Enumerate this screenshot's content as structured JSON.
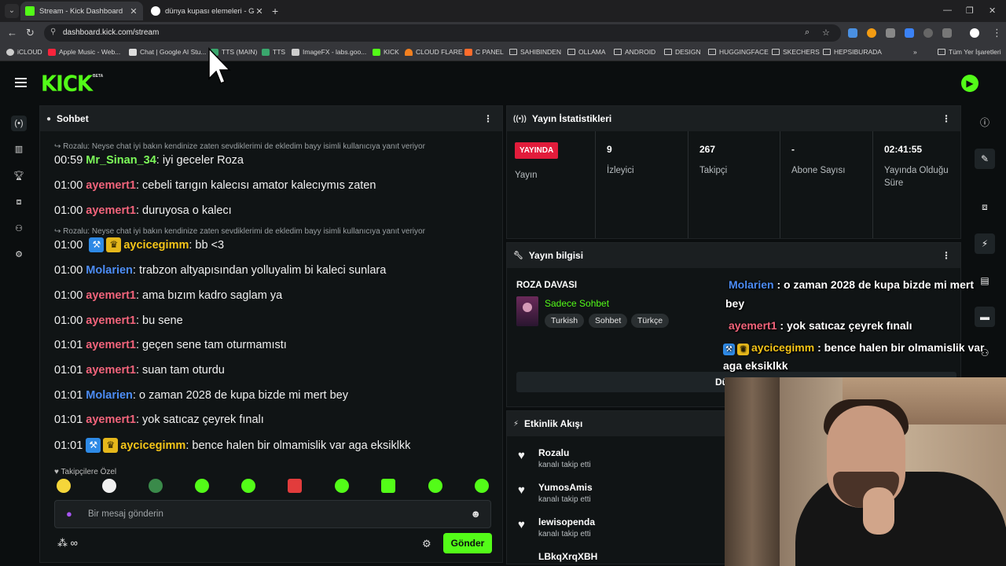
{
  "browser": {
    "tabs": [
      {
        "title": "Stream - Kick Dashboard",
        "favicon_color": "#53fc18",
        "active": true
      },
      {
        "title": "dünya kupası elemeleri - Google",
        "favicon_color": "#ffffff",
        "active": false
      }
    ],
    "url": "dashboard.kick.com/stream",
    "bookmarks": [
      {
        "label": "iCLOUD",
        "color": "#e8e8e8"
      },
      {
        "label": "Apple Music - Web...",
        "color": "#fa243c"
      },
      {
        "label": "Chat | Google AI Stu...",
        "color": "#dddddd"
      },
      {
        "label": "TTS (MAIN)",
        "color": "#3aa76d"
      },
      {
        "label": "TTS",
        "color": "#3aa76d"
      },
      {
        "label": "ImageFX - labs.goo...",
        "color": "#cccccc"
      },
      {
        "label": "KICK",
        "color": "#53fc18"
      },
      {
        "label": "CLOUD FLARE",
        "color": "#f38020"
      },
      {
        "label": "C PANEL",
        "color": "#ff6c2c"
      },
      {
        "label": "SAHIBINDEN",
        "folder": true
      },
      {
        "label": "OLLAMA",
        "folder": true
      },
      {
        "label": "ANDROID",
        "folder": true
      },
      {
        "label": "DESIGN",
        "folder": true
      },
      {
        "label": "HUGGINGFACE",
        "folder": true
      },
      {
        "label": "SKECHERS",
        "folder": true
      },
      {
        "label": "HEPSIBURADA",
        "folder": true
      }
    ],
    "all_bookmarks": "Tüm Yer İşaretleri"
  },
  "kick": {
    "logo": "KICK",
    "beta": "BETA"
  },
  "chat": {
    "title": "Sohbet",
    "messages": [
      {
        "reply": "Rozalu: Neyse chat iyi bakın kendinize zaten sevdiklerimi de ekledim bayy isimli kullanıcıya yanıt veriyor"
      },
      {
        "time": "00:59",
        "user": "Mr_Sinan_34",
        "color": "#7dfc5a",
        "text": "iyi geceler Roza"
      },
      {
        "time": "01:00",
        "user": "ayemert1",
        "color": "#f2647b",
        "text": "cebeli tarıgın kalecısı amator kalecıymıs zaten"
      },
      {
        "time": "01:00",
        "user": "ayemert1",
        "color": "#f2647b",
        "text": "duruyosa o kalecı"
      },
      {
        "reply": "Rozalu: Neyse chat iyi bakın kendinize zaten sevdiklerimi de ekledim bayy isimli kullanıcıya yanıt veriyor"
      },
      {
        "time": "01:00",
        "user": "aycicegimm",
        "color": "#f5c518",
        "text": "bb <3",
        "badges": true
      },
      {
        "time": "01:00",
        "user": "Molarien",
        "color": "#4c8cf5",
        "text": "trabzon altyapısından yolluyalim bi kaleci sunlara"
      },
      {
        "time": "01:00",
        "user": "ayemert1",
        "color": "#f2647b",
        "text": "ama bızım kadro saglam ya"
      },
      {
        "time": "01:00",
        "user": "ayemert1",
        "color": "#f2647b",
        "text": "bu sene"
      },
      {
        "time": "01:01",
        "user": "ayemert1",
        "color": "#f2647b",
        "text": "geçen sene tam oturmamıstı"
      },
      {
        "time": "01:01",
        "user": "ayemert1",
        "color": "#f2647b",
        "text": "suan tam oturdu"
      },
      {
        "time": "01:01",
        "user": "Molarien",
        "color": "#4c8cf5",
        "text": "o zaman 2028 de kupa bizde mi mert bey"
      },
      {
        "time": "01:01",
        "user": "ayemert1",
        "color": "#f2647b",
        "text": "yok satıcaz çeyrek fınalı"
      },
      {
        "time": "01:01",
        "user": "aycicegimm",
        "color": "#f5c518",
        "text": "bence halen bir olmamislik var aga eksiklkk",
        "badges": true
      }
    ],
    "follower_emotes_label": "Takipçilere Özel",
    "input_placeholder": "Bir mesaj gönderin",
    "points": "∞",
    "send_label": "Gönder"
  },
  "stats": {
    "title": "Yayın İstatistikleri",
    "live_label": "YAYINDA",
    "items": [
      {
        "value": "",
        "label": "Yayın"
      },
      {
        "value": "9",
        "label": "İzleyici"
      },
      {
        "value": "267",
        "label": "Takipçi"
      },
      {
        "value": "-",
        "label": "Abone Sayısı"
      },
      {
        "value": "02:41:55",
        "label": "Yayında Olduğu Süre"
      }
    ]
  },
  "stream_info": {
    "title": "Yayın bilgisi",
    "stream_title": "ROZA DAVASI",
    "category": "Sadece Sohbet",
    "tags": [
      "Turkish",
      "Sohbet",
      "Türkçe"
    ],
    "edit_button": "Dü"
  },
  "overlay_chat": [
    {
      "user": "Molarien",
      "color": "#4c8cf5",
      "text": ": o zaman 2028 de kupa bizde mi mert",
      "cont": "bey"
    },
    {
      "user": "ayemert1",
      "color": "#f2647b",
      "text": ": yok satıcaz çeyrek fınalı"
    },
    {
      "user": "aycicegimm",
      "color": "#f5c518",
      "text": ": bence halen bir olmamislik var",
      "cont": "aga eksiklkk"
    }
  ],
  "activity": {
    "title": "Etkinlik Akışı",
    "items": [
      {
        "name": "Rozalu",
        "sub": "kanalı takip etti"
      },
      {
        "name": "YumosAmis",
        "sub": "kanalı takip etti"
      },
      {
        "name": "lewisopenda",
        "sub": "kanalı takip etti"
      },
      {
        "name": "LBkqXrqXBH",
        "sub": ""
      }
    ]
  }
}
